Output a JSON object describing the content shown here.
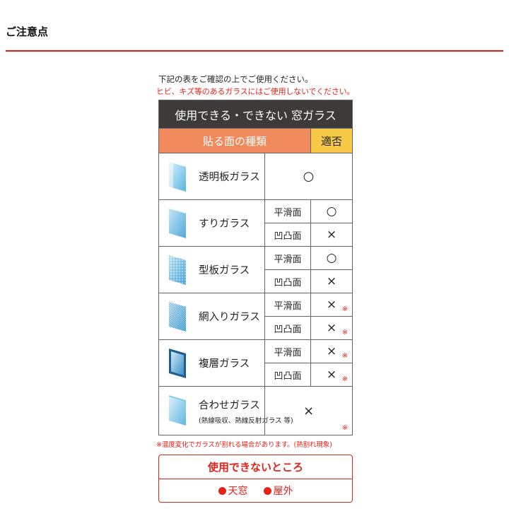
{
  "header": {
    "title": "ご注意点",
    "accent_color": "#e2231a"
  },
  "notes": {
    "line1": "下記の表をご確認の上でご使用ください。",
    "line2": "ヒビ、キズ等のあるガラスにはご使用しないでください。"
  },
  "table": {
    "title": "使用できる・できない 窓ガラス",
    "col_type": "貼る面の種類",
    "col_ok": "適否",
    "rows": [
      {
        "name": "透明板ガラス",
        "icon": "clear-glass-icon",
        "result": "○",
        "asterisk": ""
      },
      {
        "name": "すりガラス",
        "icon": "frosted-glass-icon",
        "subs": [
          {
            "surface": "平滑面",
            "result": "○",
            "asterisk": ""
          },
          {
            "surface": "凹凸面",
            "result": "×",
            "asterisk": ""
          }
        ]
      },
      {
        "name": "型板ガラス",
        "icon": "patterned-glass-icon",
        "subs": [
          {
            "surface": "平滑面",
            "result": "○",
            "asterisk": ""
          },
          {
            "surface": "凹凸面",
            "result": "×",
            "asterisk": ""
          }
        ]
      },
      {
        "name": "網入りガラス",
        "icon": "wired-glass-icon",
        "subs": [
          {
            "surface": "平滑面",
            "result": "×",
            "asterisk": "※"
          },
          {
            "surface": "凹凸面",
            "result": "×",
            "asterisk": "※"
          }
        ]
      },
      {
        "name": "複層ガラス",
        "icon": "double-glazed-glass-icon",
        "subs": [
          {
            "surface": "平滑面",
            "result": "×",
            "asterisk": "※"
          },
          {
            "surface": "凹凸面",
            "result": "×",
            "asterisk": "※"
          }
        ]
      },
      {
        "name": "合わせガラス",
        "sub": "(熱線吸収、熱線反射ガラス 等)",
        "icon": "laminated-glass-icon",
        "result": "×",
        "asterisk": "※"
      }
    ]
  },
  "footnote": "※温度変化でガラスが割れる場合があります。(熱割れ現象)",
  "no_use": {
    "title": "使用できないところ",
    "items": [
      "天窓",
      "屋外"
    ]
  }
}
